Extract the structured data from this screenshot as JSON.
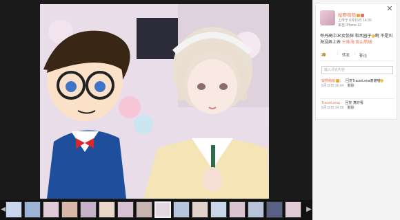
{
  "post": {
    "username": "桜野萌萌",
    "time": "6月15日 14:30",
    "time_prefix": "上传于",
    "source": "来自 iPhone 12",
    "text_line1": "帝丹高中JK女侦探 和木园子",
    "text_line1_tail": "啊 不是叫",
    "text_line2": "海没弄上去 ",
    "location": "珠海·前山新城",
    "like_count": "20",
    "repost_label": "转发",
    "comment_label": "评论",
    "comment_count": "2",
    "comment_placeholder": "输入评论内容"
  },
  "comments": [
    {
      "user": "桜野萌萌",
      "text": "TracerLena谢谢喵",
      "time": "6月15日 16:44",
      "reply": "回复",
      "delete": "删除"
    },
    {
      "user": "TracerLena",
      "text": "真好看",
      "time": "6月15日 14:39",
      "reply": "回复",
      "delete": "删除"
    }
  ],
  "colors": {
    "accent": "#eb7350",
    "panel_bg": "#f4f4f4",
    "viewer_bg": "#1a1a1a"
  },
  "icons": {
    "close": "close-icon",
    "like": "like-icon",
    "prev": "chevron-left-icon",
    "next": "chevron-right-icon"
  }
}
